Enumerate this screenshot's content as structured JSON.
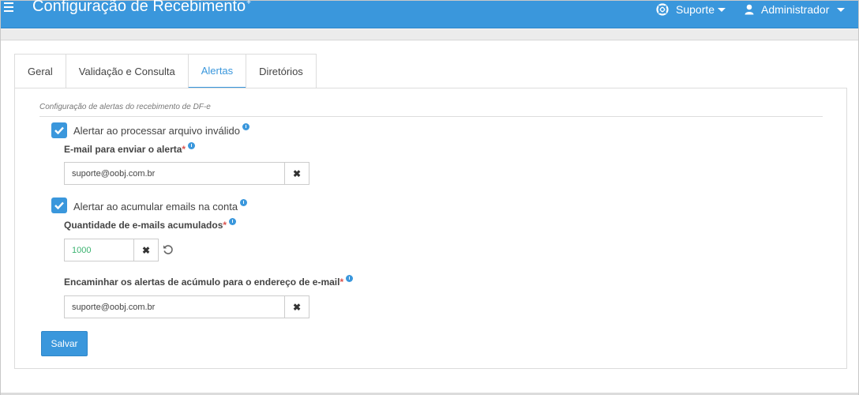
{
  "header": {
    "title": "Configuração de Recebimento",
    "title_sup": "+",
    "support_label": "Suporte",
    "admin_label": "Administrador"
  },
  "tabs": [
    {
      "label": "Geral"
    },
    {
      "label": "Validação e Consulta"
    },
    {
      "label": "Alertas",
      "active": true
    },
    {
      "label": "Diretórios"
    }
  ],
  "section": {
    "title": "Configuração de alertas do recebimento de DF-e"
  },
  "alert_invalid": {
    "checked": true,
    "label": "Alertar ao processar arquivo inválido",
    "email_label": "E-mail para enviar o alerta",
    "required_mark": "*",
    "email_value": "suporte@oobj.com.br"
  },
  "alert_accumulate": {
    "checked": true,
    "label": "Alertar ao acumular emails na conta",
    "quantity_label": "Quantidade de e-mails acumulados",
    "required_mark": "*",
    "quantity_value": "1000",
    "forward_label": "Encaminhar os alertas de acúmulo para o endereço de e-mail",
    "forward_value": "suporte@oobj.com.br"
  },
  "buttons": {
    "save_label": "Salvar",
    "clear_symbol": "✖"
  },
  "colors": {
    "accent": "#3a97dc",
    "required": "#d9534f",
    "quantity_text": "#3cb371"
  }
}
